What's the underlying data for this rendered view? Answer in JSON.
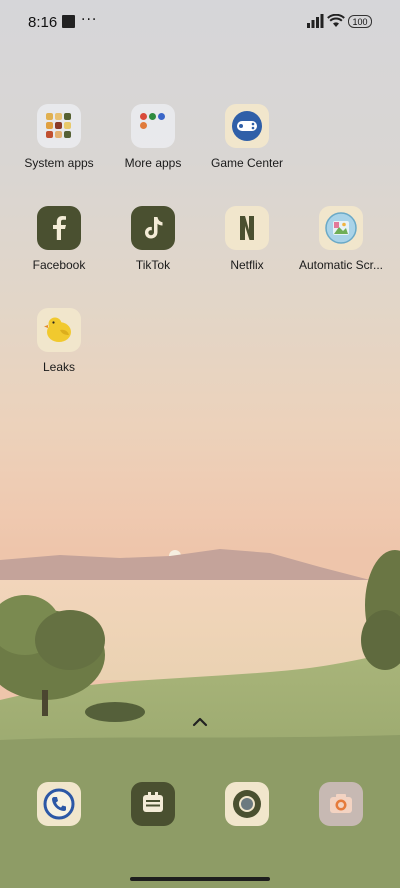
{
  "status_bar": {
    "time": "8:16",
    "notification_dots": "···",
    "battery": "100"
  },
  "apps": {
    "system_apps": "System apps",
    "more_apps": "More apps",
    "game_center": "Game Center",
    "facebook": "Facebook",
    "tiktok": "TikTok",
    "netflix": "Netflix",
    "automatic_screenshot": "Automatic Scr...",
    "leaks": "Leaks"
  },
  "colors": {
    "app_dark": "#4a5030",
    "app_cream": "#f1e6cc"
  }
}
